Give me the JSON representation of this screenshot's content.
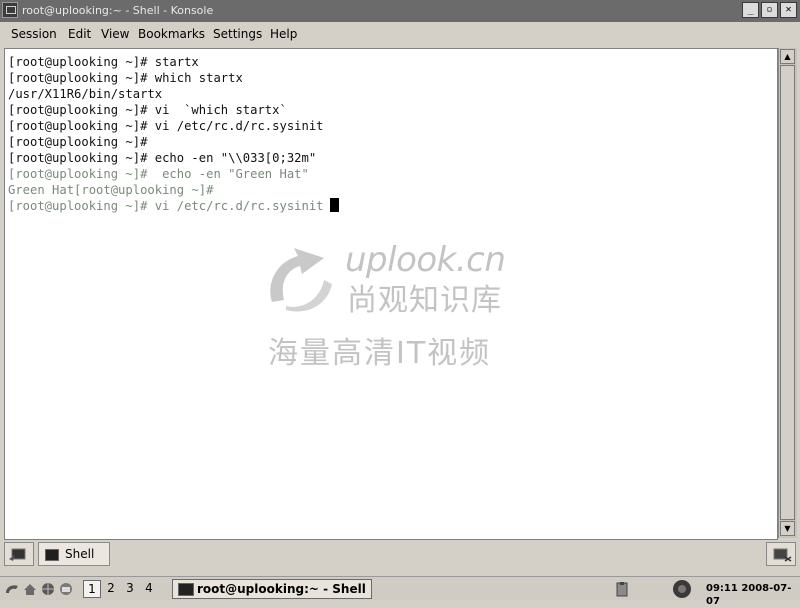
{
  "window": {
    "title": "root@uplooking:~ - Shell - Konsole"
  },
  "menu": [
    "Session",
    "Edit",
    "View",
    "Bookmarks",
    "Settings",
    "Help"
  ],
  "terminal": {
    "lines": [
      {
        "text": "[root@uplooking ~]# startx",
        "color": "#111111"
      },
      {
        "text": "[root@uplooking ~]# which startx",
        "color": "#111111"
      },
      {
        "text": "/usr/X11R6/bin/startx",
        "color": "#111111"
      },
      {
        "text": "[root@uplooking ~]# vi  `which startx`",
        "color": "#111111"
      },
      {
        "text": "[root@uplooking ~]# vi /etc/rc.d/rc.sysinit",
        "color": "#111111"
      },
      {
        "text": "[root@uplooking ~]#",
        "color": "#111111"
      },
      {
        "text": "[root@uplooking ~]# echo -en \"\\\\033[0;32m\"",
        "color": "#111111"
      },
      {
        "text": "[root@uplooking ~]#  echo -en \"Green Hat\"",
        "color": "#7a8a7a"
      },
      {
        "text": "Green Hat[root@uplooking ~]#",
        "color": "#7a8a7a"
      },
      {
        "text": "[root@uplooking ~]# vi /etc/rc.d/rc.sysinit",
        "color": "#7a8a7a"
      }
    ]
  },
  "watermark": {
    "title": "uplook.cn",
    "line1": "尚观知识库",
    "line2": "海量高清IT视频"
  },
  "tabs": [
    {
      "label": "Shell",
      "active": true
    }
  ],
  "taskbar": {
    "desktops": [
      "1",
      "2",
      "3",
      "4"
    ],
    "active_desktop": "1",
    "task_label": "root@uplooking:~ - Shell",
    "clock": "09:11 2008-07-07"
  },
  "icons": {
    "window_menu": "konsole-icon",
    "minimize": "minimize-icon",
    "maximize": "maximize-icon",
    "close": "close-icon",
    "new_tab": "new-session-icon",
    "close_tab": "close-session-icon",
    "kde_menu": "kde-menu-icon",
    "browser": "globe-icon",
    "mail": "mail-icon",
    "clipboard": "klipper-icon",
    "sound": "speaker-icon"
  }
}
